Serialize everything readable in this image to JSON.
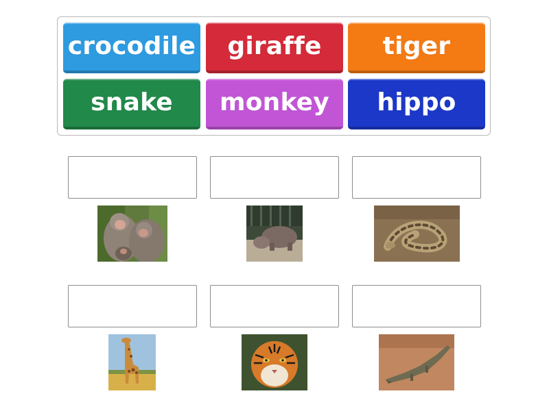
{
  "word_bank": {
    "tiles": [
      {
        "label": "crocodile",
        "color": "#2e9be0"
      },
      {
        "label": "giraffe",
        "color": "#d42a39"
      },
      {
        "label": "tiger",
        "color": "#f47a14"
      },
      {
        "label": "snake",
        "color": "#21894a"
      },
      {
        "label": "monkey",
        "color": "#c255d6"
      },
      {
        "label": "hippo",
        "color": "#1b38c8"
      }
    ]
  },
  "targets": [
    {
      "picture": "monkey-photo",
      "answer": ""
    },
    {
      "picture": "hippo-photo",
      "answer": ""
    },
    {
      "picture": "snake-photo",
      "answer": ""
    },
    {
      "picture": "giraffe-photo",
      "answer": ""
    },
    {
      "picture": "tiger-photo",
      "answer": ""
    },
    {
      "picture": "crocodile-photo",
      "answer": ""
    }
  ]
}
